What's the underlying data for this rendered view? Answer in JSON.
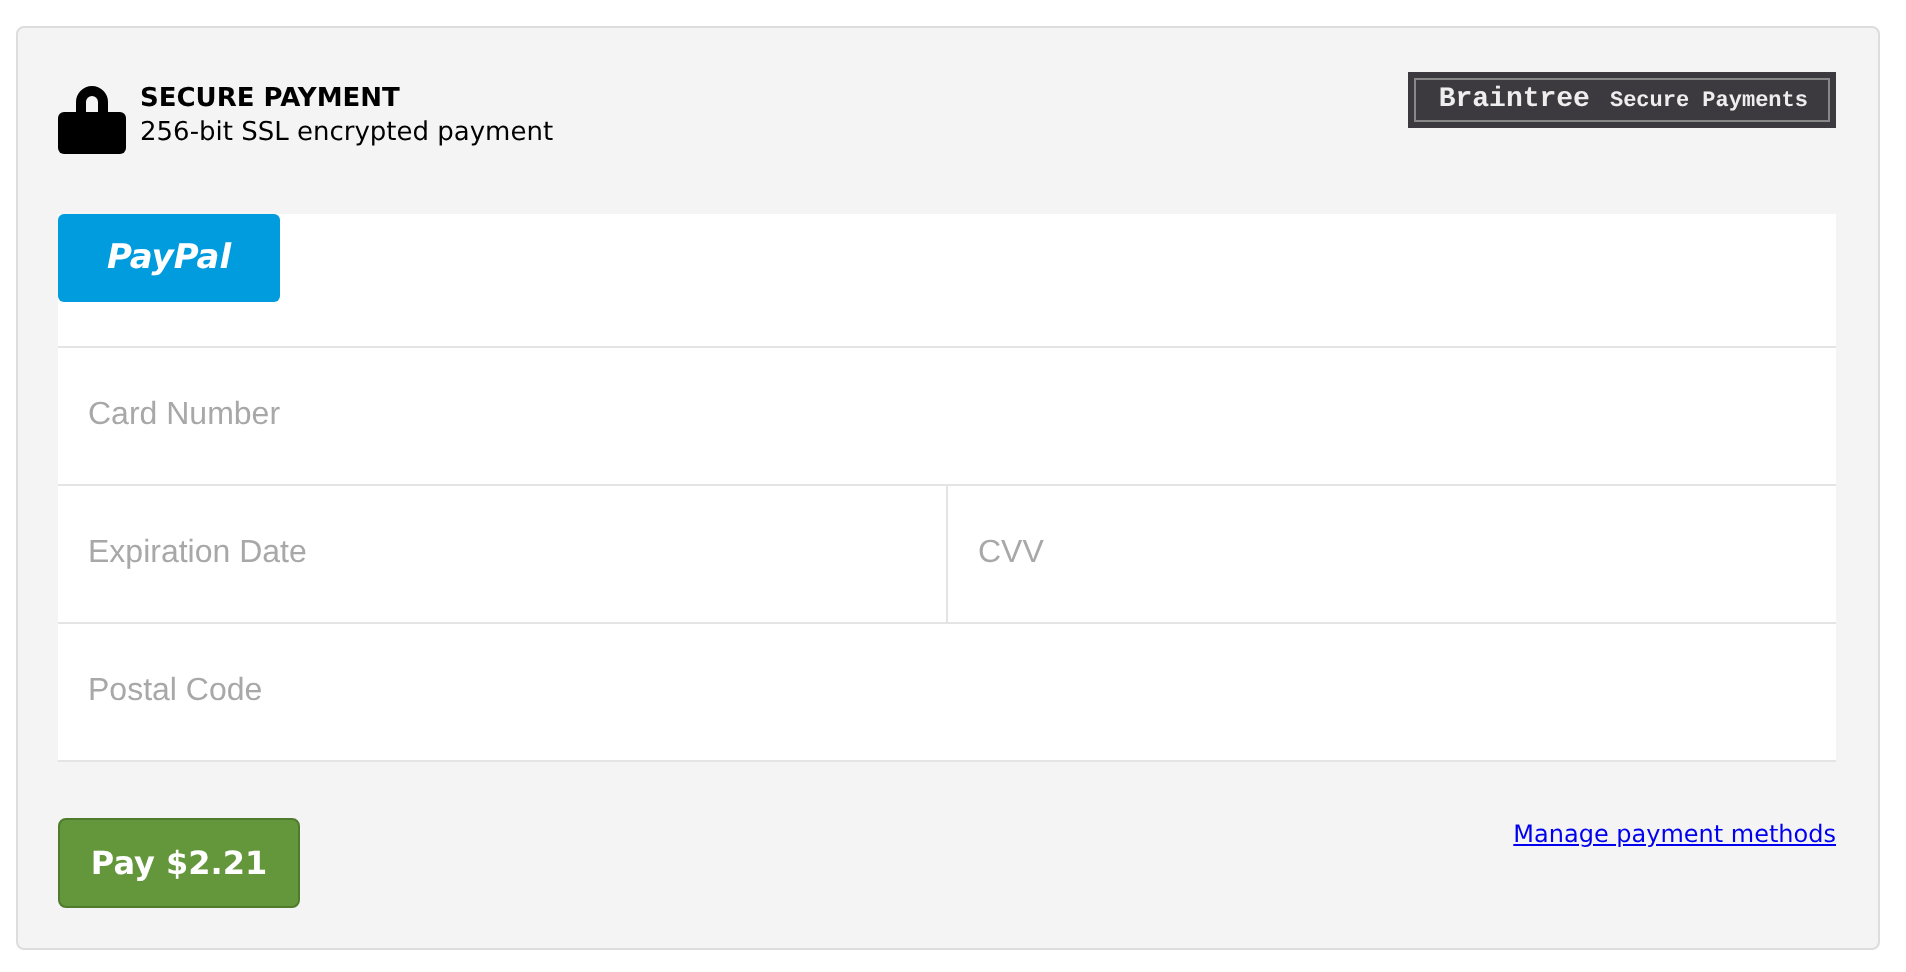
{
  "header": {
    "title": "SECURE PAYMENT",
    "subtitle": "256-bit SSL encrypted payment"
  },
  "badge": {
    "brand": "Braintree",
    "text": "Secure Payments"
  },
  "paypal_button": {
    "label": "PayPal"
  },
  "fields": [
    [
      {
        "placeholder": "Card Number"
      }
    ],
    [
      {
        "placeholder": "Expiration Date"
      },
      {
        "placeholder": "CVV"
      }
    ],
    [
      {
        "placeholder": "Postal Code"
      }
    ]
  ],
  "pay_button": {
    "label": "Pay $2.21"
  },
  "manage_link": {
    "label": "Manage payment methods"
  }
}
